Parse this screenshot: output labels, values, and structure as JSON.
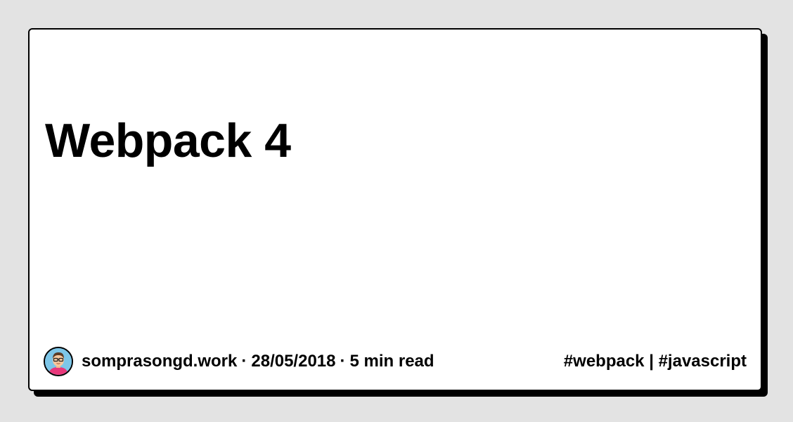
{
  "post": {
    "title": "Webpack 4"
  },
  "footer": {
    "author": "somprasongd.work",
    "separator": "·",
    "date": "28/05/2018",
    "read_time": "5 min read",
    "tags": "#webpack | #javascript",
    "avatar_icon": "person-avatar-icon"
  },
  "colors": {
    "background": "#e3e3e3",
    "card": "#ffffff",
    "border": "#000000",
    "text": "#000000"
  }
}
